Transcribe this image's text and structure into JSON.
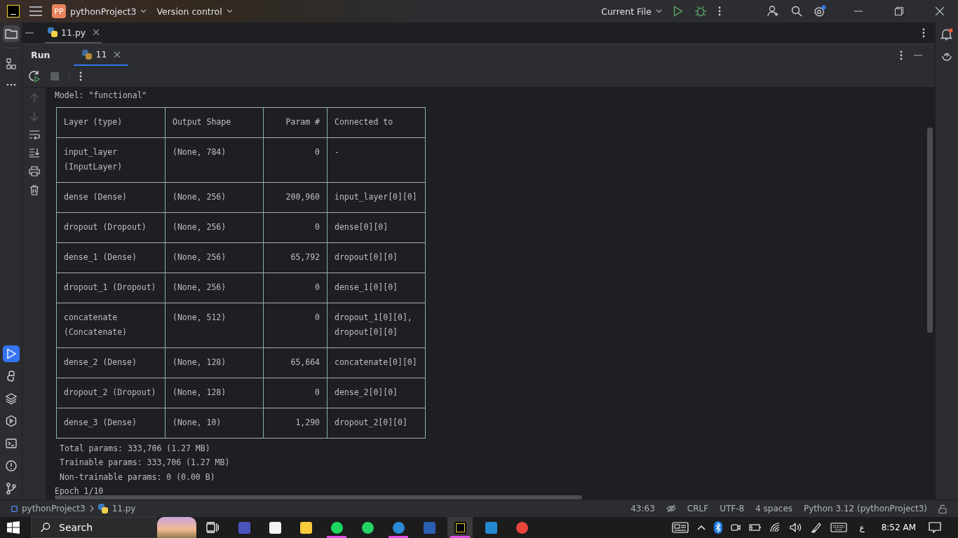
{
  "title_bar": {
    "project_badge": "PP",
    "project": "pythonProject3",
    "vcs": "Version control",
    "run_config": "Current File",
    "settings_badge": true
  },
  "editor_tabs": [
    {
      "label": "11.py",
      "selected": true
    }
  ],
  "run_panel": {
    "title": "Run",
    "tabs": [
      {
        "label": "11",
        "selected": true
      }
    ]
  },
  "console_toolbar": {
    "stop_disabled": true
  },
  "tool_strip": {
    "top": [
      {
        "selected": true
      },
      {
        "selected": false
      },
      {
        "selected": false
      }
    ],
    "bottom": [
      {
        "selected": true
      },
      {
        "selected": false
      },
      {
        "selected": false
      },
      {
        "selected": false
      },
      {
        "selected": false
      },
      {
        "selected": false
      },
      {
        "selected": false
      }
    ]
  },
  "notifications": {
    "unread": true
  },
  "console": {
    "lines_before": [
      "Model: \"functional\""
    ],
    "table": {
      "columns": [
        "Layer (type)",
        "Output Shape",
        "Param #",
        "Connected to"
      ],
      "rows": [
        [
          "input_layer\n(InputLayer)",
          "(None, 784)",
          "0",
          "-"
        ],
        [
          "dense (Dense)",
          "(None, 256)",
          "200,960",
          "input_layer[0][0]"
        ],
        [
          "dropout (Dropout)",
          "(None, 256)",
          "0",
          "dense[0][0]"
        ],
        [
          "dense_1 (Dense)",
          "(None, 256)",
          "65,792",
          "dropout[0][0]"
        ],
        [
          "dropout_1 (Dropout)",
          "(None, 256)",
          "0",
          "dense_1[0][0]"
        ],
        [
          "concatenate\n(Concatenate)",
          "(None, 512)",
          "0",
          "dropout_1[0][0],\ndropout[0][0]"
        ],
        [
          "dense_2 (Dense)",
          "(None, 128)",
          "65,664",
          "concatenate[0][0]"
        ],
        [
          "dropout_2 (Dropout)",
          "(None, 128)",
          "0",
          "dense_2[0][0]"
        ],
        [
          "dense_3 (Dense)",
          "(None, 10)",
          "1,290",
          "dropout_2[0][0]"
        ]
      ]
    },
    "summary": [
      "Total params: 333,706 (1.27 MB)",
      "Trainable params: 333,706 (1.27 MB)",
      "Non-trainable params: 0 (0.00 B)"
    ],
    "lines_after": [
      "Epoch 1/10"
    ]
  },
  "status_bar": {
    "breadcrumbs": [
      "pythonProject3",
      "11.py"
    ],
    "position": "43:63",
    "line_separator": "CRLF",
    "encoding": "UTF-8",
    "indent": "4 spaces",
    "interpreter": "Python 3.12 (pythonProject3)"
  },
  "taskbar": {
    "search_placeholder": "Search",
    "apps": [
      {
        "running": false,
        "selected": false
      },
      {
        "running": false,
        "selected": false
      },
      {
        "running": false,
        "selected": false
      },
      {
        "running": true,
        "selected": false
      },
      {
        "running": false,
        "selected": false
      },
      {
        "running": true,
        "selected": false
      },
      {
        "running": false,
        "selected": false
      },
      {
        "running": true,
        "selected": true
      },
      {
        "running": false,
        "selected": false
      },
      {
        "running": false,
        "selected": false
      }
    ],
    "language": "ع",
    "time": "8:52 AM"
  }
}
